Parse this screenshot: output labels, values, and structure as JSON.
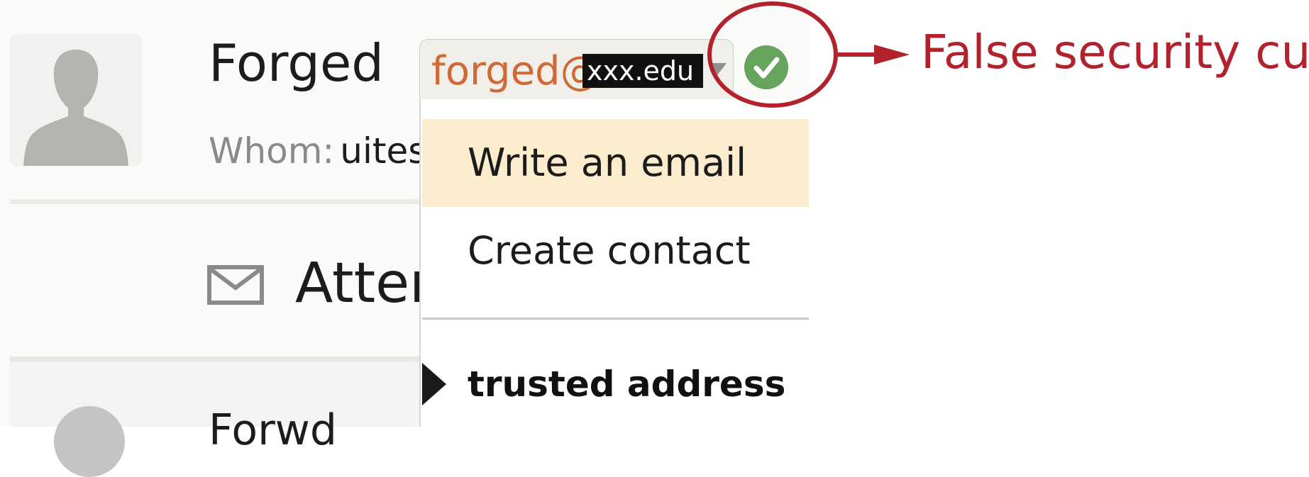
{
  "sender": {
    "name": "Forged",
    "whom_label": "Whom:",
    "whom_value": "uites"
  },
  "address": {
    "user_part": "forged@",
    "domain": "xxx.edu"
  },
  "section": {
    "title": "Atter"
  },
  "bottom": {
    "text": "Forwd"
  },
  "menu": {
    "items": [
      {
        "label": "Write an email",
        "highlighted": true
      },
      {
        "label": "Create contact",
        "highlighted": false
      }
    ],
    "trusted_label": "trusted address"
  },
  "annotation": {
    "label": "False security cue",
    "color": "#b2222d"
  },
  "colors": {
    "verified_green": "#66a35c",
    "sender_orange": "#cf6a36",
    "menu_highlight": "#faeccc"
  },
  "icons": [
    "avatar-placeholder-icon",
    "mail-icon",
    "info-icon",
    "chevron-down-icon",
    "verified-check-icon",
    "triangle-pointer-icon"
  ]
}
